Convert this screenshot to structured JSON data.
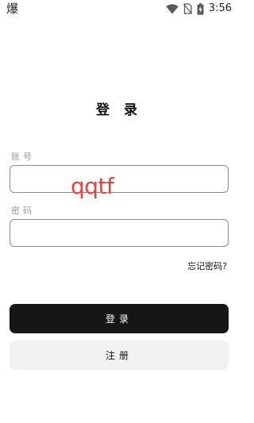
{
  "status_bar": {
    "left_glyph": "爆",
    "time": "3:56",
    "icons": [
      "wifi-icon",
      "no-sim-icon",
      "battery-charging-icon"
    ]
  },
  "page": {
    "title": "登 录"
  },
  "form": {
    "account_label": "账号",
    "account_value": "",
    "password_label": "密码",
    "password_value": "",
    "overlay_text": "qqtf",
    "forgot_password": "忘记密码?"
  },
  "buttons": {
    "login": "登录",
    "register": "注册"
  },
  "colors": {
    "primary_button": "#161616",
    "secondary_button": "#f2f2f2",
    "overlay_text": "#e8413b",
    "label_gray": "#9a9a9a"
  }
}
